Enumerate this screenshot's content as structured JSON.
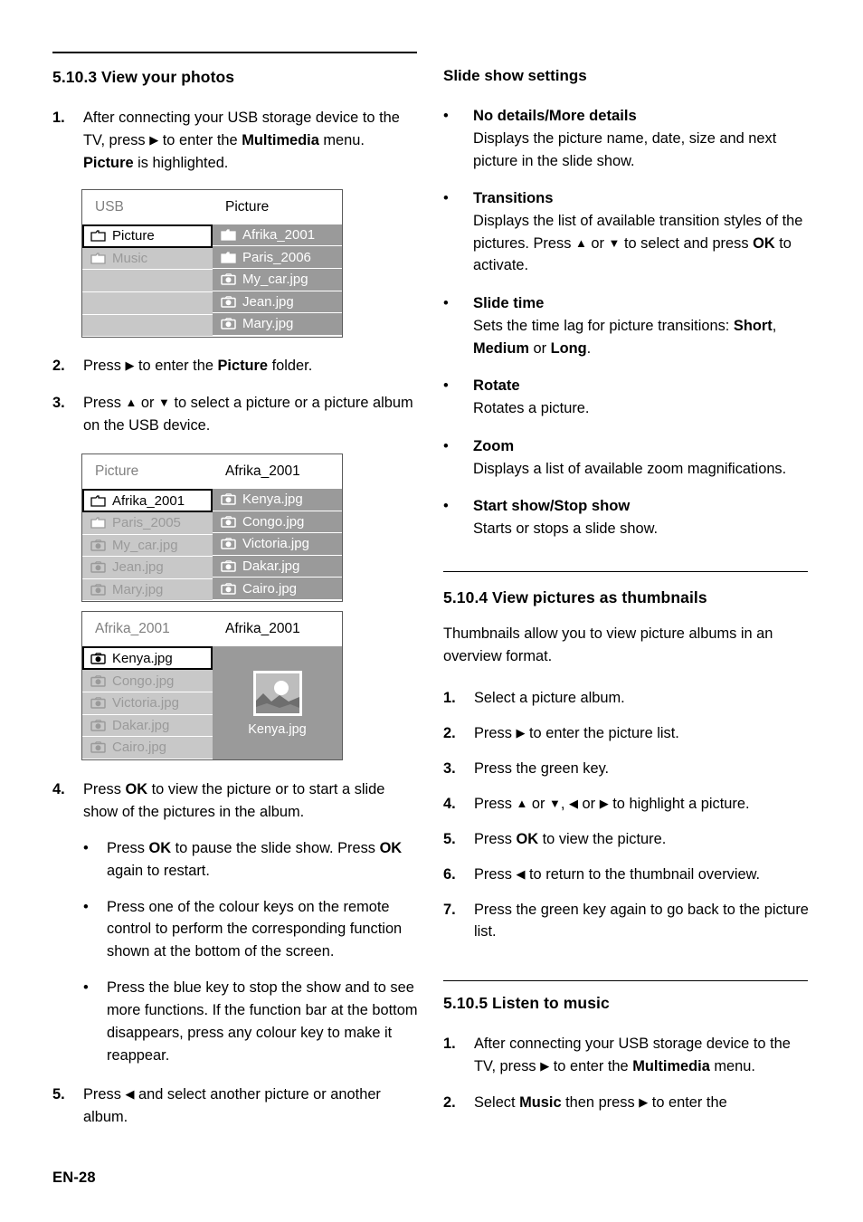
{
  "page": {
    "footer": "EN-28"
  },
  "left": {
    "section": {
      "number": "5.10.3",
      "title": "View your photos"
    },
    "step1": {
      "marker": "1.",
      "part1": "After connecting your USB storage device to the TV, press ",
      "arrow": "▶",
      "part2": " to enter the ",
      "bold1": "Multimedia",
      "part3": " menu. ",
      "bold2": "Picture",
      "part4": " is highlighted."
    },
    "step2": {
      "marker": "2.",
      "part1": "Press ",
      "arrow": "▶",
      "part2": " to enter the ",
      "bold1": "Picture",
      "part3": " folder."
    },
    "step3": {
      "marker": "3.",
      "part1": "Press ",
      "arrow_up": "▲",
      "part2": " or ",
      "arrow_down": "▼",
      "part3": " to select a picture or a picture album on the USB device."
    },
    "step4": {
      "marker": "4.",
      "part1": "Press ",
      "bold1": "OK",
      "part2": " to view the picture or to start a slide show of the pictures in the album.",
      "bullets": [
        {
          "part1": "Press ",
          "bold1": "OK",
          "part2": " to pause the slide show. Press ",
          "bold2": "OK",
          "part3": " again to restart."
        },
        {
          "part1": "Press one of the colour keys on the remote control to perform the corresponding function shown at the bottom of the screen.",
          "bold1": "",
          "part2": "",
          "bold2": "",
          "part3": ""
        },
        {
          "part1": "Press the blue key to stop the show and to see more functions. If the function bar at the bottom disappears, press any colour key to make it reappear.",
          "bold1": "",
          "part2": "",
          "bold2": "",
          "part3": ""
        }
      ]
    },
    "step5": {
      "marker": "5.",
      "part1": "Press ",
      "arrow": "◀",
      "part2": " and select another picture or another album."
    },
    "mockups": [
      {
        "id": "usb-picture",
        "header_left": "USB",
        "header_right": "Picture",
        "left_items": [
          {
            "icon": "folder-icon",
            "label": "Picture",
            "selected": true
          },
          {
            "icon": "folder-icon",
            "label": "Music",
            "selected": false
          },
          {
            "icon": "none",
            "label": "",
            "selected": false
          },
          {
            "icon": "none",
            "label": "",
            "selected": false
          },
          {
            "icon": "none",
            "label": "",
            "selected": false
          }
        ],
        "right_items": [
          {
            "icon": "folder-icon",
            "label": "Afrika_2001"
          },
          {
            "icon": "folder-icon",
            "label": "Paris_2006"
          },
          {
            "icon": "camera-icon",
            "label": "My_car.jpg"
          },
          {
            "icon": "camera-icon",
            "label": "Jean.jpg"
          },
          {
            "icon": "camera-icon",
            "label": "Mary.jpg"
          }
        ],
        "preview": null
      },
      {
        "id": "picture-afrika",
        "header_left": "Picture",
        "header_right": "Afrika_2001",
        "left_items": [
          {
            "icon": "folder-icon",
            "label": "Afrika_2001",
            "selected": true
          },
          {
            "icon": "folder-icon",
            "label": "Paris_2005",
            "selected": false
          },
          {
            "icon": "camera-icon",
            "label": "My_car.jpg",
            "selected": false
          },
          {
            "icon": "camera-icon",
            "label": "Jean.jpg",
            "selected": false
          },
          {
            "icon": "camera-icon",
            "label": "Mary.jpg",
            "selected": false
          }
        ],
        "right_items": [
          {
            "icon": "camera-icon",
            "label": "Kenya.jpg"
          },
          {
            "icon": "camera-icon",
            "label": "Congo.jpg"
          },
          {
            "icon": "camera-icon",
            "label": "Victoria.jpg"
          },
          {
            "icon": "camera-icon",
            "label": "Dakar.jpg"
          },
          {
            "icon": "camera-icon",
            "label": "Cairo.jpg"
          }
        ],
        "preview": null
      },
      {
        "id": "afrika-preview",
        "header_left": "Afrika_2001",
        "header_right": "Afrika_2001",
        "left_items": [
          {
            "icon": "camera-icon",
            "label": "Kenya.jpg",
            "selected": true
          },
          {
            "icon": "camera-icon",
            "label": "Congo.jpg",
            "selected": false
          },
          {
            "icon": "camera-icon",
            "label": "Victoria.jpg",
            "selected": false
          },
          {
            "icon": "camera-icon",
            "label": "Dakar.jpg",
            "selected": false
          },
          {
            "icon": "camera-icon",
            "label": "Cairo.jpg",
            "selected": false
          }
        ],
        "right_items": [],
        "preview": {
          "caption": "Kenya.jpg",
          "thumb": "sunset-mountain-thumbnail"
        }
      }
    ]
  },
  "right": {
    "slideshow": {
      "heading": "Slide show settings",
      "items": [
        {
          "term": "No details/More details",
          "desc_1": "Displays the picture name, date, size and next picture in the slide show.",
          "desc_2": "",
          "bold_a": "",
          "desc_3": "",
          "bold_b": "",
          "desc_4": "",
          "bold_c": "",
          "desc_5": ""
        },
        {
          "term": "Transitions",
          "desc_1": "Displays the list of available transition styles of the pictures. Press ",
          "desc_2": "▲",
          "bold_a": " or ",
          "desc_3": "▼",
          "bold_b": " to select and press ",
          "desc_4": "OK",
          "bold_c": " to activate.",
          "desc_5": ""
        },
        {
          "term": "Slide time",
          "desc_1": "Sets the time lag for picture transitions: ",
          "desc_2": "Short",
          "bold_a": ", ",
          "desc_3": "Medium",
          "bold_b": " or ",
          "desc_4": "Long",
          "bold_c": ".",
          "desc_5": ""
        },
        {
          "term": "Rotate",
          "desc_1": "Rotates a picture.",
          "desc_2": "",
          "bold_a": "",
          "desc_3": "",
          "bold_b": "",
          "desc_4": "",
          "bold_c": "",
          "desc_5": ""
        },
        {
          "term": "Zoom",
          "desc_1": "Displays a list of available zoom magnifications.",
          "desc_2": "",
          "bold_a": "",
          "desc_3": "",
          "bold_b": "",
          "desc_4": "",
          "bold_c": "",
          "desc_5": ""
        },
        {
          "term": "Start show/Stop show",
          "desc_1": "Starts or stops a slide show.",
          "desc_2": "",
          "bold_a": "",
          "desc_3": "",
          "bold_b": "",
          "desc_4": "",
          "bold_c": "",
          "desc_5": ""
        }
      ]
    },
    "thumbnails": {
      "section": {
        "number": "5.10.4",
        "title": "View pictures as thumbnails"
      },
      "intro": "Thumbnails allow you to view picture albums in an overview format.",
      "steps": [
        {
          "marker": "1.",
          "p1": "Select a picture album.",
          "a1": "",
          "p2": "",
          "a2": "",
          "p3": "",
          "b1": "",
          "p4": ""
        },
        {
          "marker": "2.",
          "p1": "Press ",
          "a1": "▶",
          "p2": " to enter the picture list.",
          "a2": "",
          "p3": "",
          "b1": "",
          "p4": ""
        },
        {
          "marker": "3.",
          "p1": "Press the green key.",
          "a1": "",
          "p2": "",
          "a2": "",
          "p3": "",
          "b1": "",
          "p4": ""
        },
        {
          "marker": "4.",
          "p1": "Press ",
          "a1": "▲",
          "p2": " or ",
          "a2": "▼",
          "p3": ", ",
          "b1": "◀",
          "p4": " or "
        },
        {
          "marker": "5.",
          "p1": "Press ",
          "a1": "",
          "p2": "",
          "a2": "",
          "p3": "",
          "b1": "OK",
          "p4": " to view the picture."
        },
        {
          "marker": "6.",
          "p1": "Press ",
          "a1": "◀",
          "p2": " to return to the thumbnail overview.",
          "a2": "",
          "p3": "",
          "b1": "",
          "p4": ""
        },
        {
          "marker": "7.",
          "p1": "Press the green key again to go back to the picture list.",
          "a1": "",
          "p2": "",
          "a2": "",
          "p3": "",
          "b1": "",
          "p4": ""
        }
      ],
      "step4_tail_arrow": "▶",
      "step4_tail": " to highlight a picture."
    },
    "music": {
      "section": {
        "number": "5.10.5",
        "title": "Listen to music"
      },
      "step1": {
        "marker": "1.",
        "part1": "After connecting your USB storage device to the TV, press ",
        "arrow": "▶",
        "part2": " to enter the ",
        "bold1": "Multimedia",
        "part3": " menu."
      },
      "step2": {
        "marker": "2.",
        "part1": "Select ",
        "bold1": "Music",
        "part2": " then press ",
        "arrow": "▶",
        "part3": " to enter the"
      }
    }
  },
  "colors": {
    "pane_left_bg": "#c8c8c8",
    "pane_left_text": "#9a9a9a",
    "pane_right_bg": "#9a9a9a",
    "pane_right_text": "#ffffff",
    "selected_bg": "#ffffff",
    "selected_text": "#000000",
    "header_dim_text": "#808080"
  }
}
